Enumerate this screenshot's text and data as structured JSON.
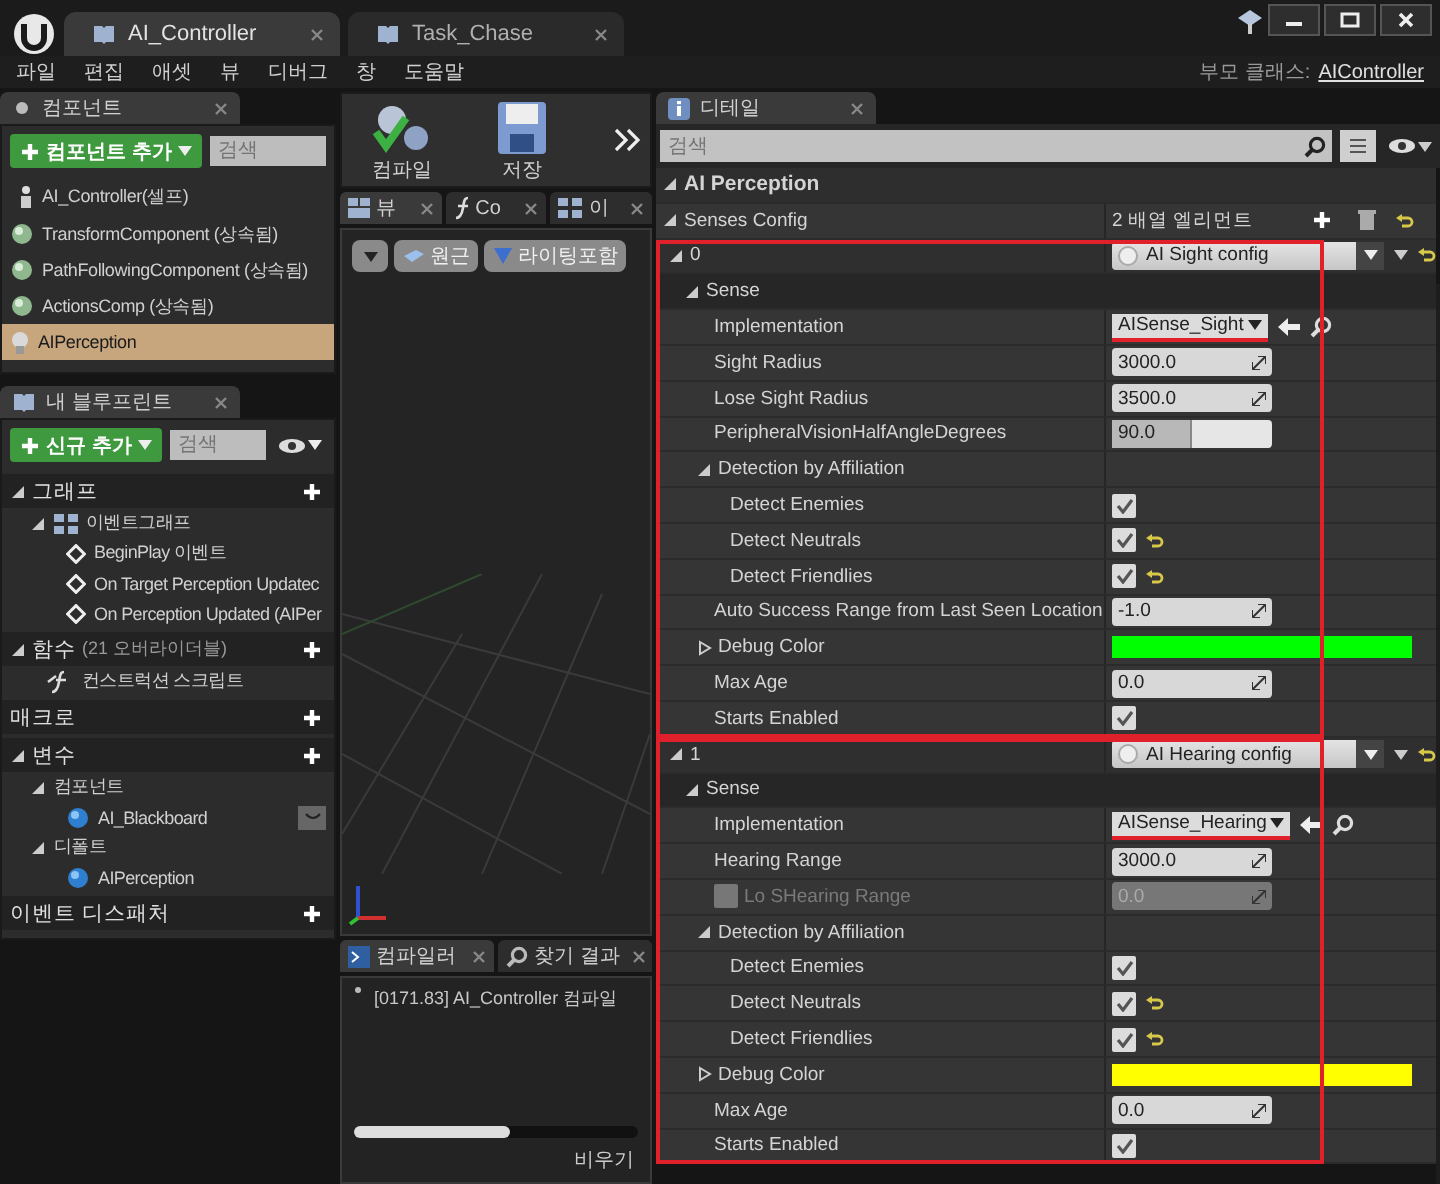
{
  "title_bar": {
    "tabs": [
      {
        "label": "AI_Controller",
        "selected": true
      },
      {
        "label": "Task_Chase",
        "selected": false
      }
    ]
  },
  "menu": {
    "items": [
      "파일",
      "편집",
      "애셋",
      "뷰",
      "디버그",
      "창",
      "도움말"
    ],
    "parent_label": "부모 클래스:",
    "parent_value": "AIController"
  },
  "components": {
    "tab": "컴포넌트",
    "add_button": "컴포넌트 추가",
    "search_placeholder": "검색",
    "items": [
      {
        "label": "AI_Controller(셀프)",
        "kind": "self",
        "selected": false
      },
      {
        "label": "TransformComponent (상속됨)",
        "kind": "component",
        "selected": false
      },
      {
        "label": "PathFollowingComponent (상속됨)",
        "kind": "component",
        "selected": false
      },
      {
        "label": "ActionsComp (상속됨)",
        "kind": "component",
        "selected": false
      },
      {
        "label": "AIPerception",
        "kind": "perception",
        "selected": true
      }
    ]
  },
  "my_blueprint": {
    "tab": "내 블루프린트",
    "add_button": "신규 추가",
    "search_placeholder": "검색",
    "sections": [
      {
        "label": "그래프",
        "expanded": true,
        "addable": true,
        "children": [
          {
            "label": "이벤트그래프",
            "kind": "graph",
            "expanded": true,
            "children": [
              {
                "label": "BeginPlay 이벤트",
                "kind": "event"
              },
              {
                "label": "On Target Perception Updatec",
                "kind": "event"
              },
              {
                "label": "On Perception Updated (AIPer",
                "kind": "event"
              }
            ]
          }
        ]
      },
      {
        "label": "함수",
        "note": "(21 오버라이더블)",
        "expanded": true,
        "addable": true,
        "children": [
          {
            "label": "컨스트럭션 스크립트",
            "kind": "function"
          }
        ]
      },
      {
        "label": "매크로",
        "addable": true
      },
      {
        "label": "변수",
        "expanded": true,
        "addable": true,
        "children": [
          {
            "label": "컴포넌트",
            "kind": "category",
            "expanded": true,
            "children": [
              {
                "label": "AI_Blackboard",
                "kind": "variable",
                "toggle": true
              }
            ]
          },
          {
            "label": "디폴트",
            "kind": "category",
            "expanded": true,
            "children": [
              {
                "label": "AIPerception",
                "kind": "variable"
              }
            ]
          }
        ]
      },
      {
        "label": "이벤트 디스패처",
        "addable": true
      }
    ]
  },
  "toolbar": {
    "buttons": [
      {
        "label": "컴파일",
        "kind": "compile"
      },
      {
        "label": "저장",
        "kind": "save"
      }
    ]
  },
  "graph_tabs": [
    {
      "label": "뷰",
      "kind": "viewport",
      "selected": true
    },
    {
      "label": "Co",
      "kind": "function",
      "selected": false
    },
    {
      "label": "이",
      "kind": "graph",
      "selected": false
    }
  ],
  "viewport": {
    "buttons": [
      {
        "label": "원근",
        "kind": "perspective"
      },
      {
        "label": "라이팅포함",
        "kind": "lit"
      }
    ]
  },
  "compiler": {
    "tabs": [
      {
        "label": "컴파일러",
        "kind": "compiler",
        "selected": true
      },
      {
        "label": "찾기 결과",
        "kind": "find",
        "selected": false
      }
    ],
    "log": [
      "[0171.83] AI_Controller 컴파일"
    ],
    "clear_button": "비우기"
  },
  "details": {
    "tab": "디테일",
    "search_placeholder": "검색",
    "category": {
      "label": "AI Perception",
      "expanded": true
    },
    "senses_config": {
      "label": "Senses Config",
      "expanded": true,
      "count": "2 배열 엘리먼트"
    },
    "elements": [
      {
        "index": "0",
        "expanded": true,
        "config": "AI Sight config",
        "highlighted": true,
        "group": {
          "label": "Sense",
          "expanded": true,
          "rows": [
            {
              "kind": "class",
              "label": "Implementation",
              "value": "AISense_Sight",
              "underlined": true
            },
            {
              "kind": "number",
              "label": "Sight Radius",
              "value": "3000.0"
            },
            {
              "kind": "number",
              "label": "Lose Sight Radius",
              "value": "3500.0"
            },
            {
              "kind": "slider",
              "label": "PeripheralVisionHalfAngleDegrees",
              "value": "90.0",
              "level": 0.5
            },
            {
              "kind": "group",
              "label": "Detection by Affiliation",
              "expanded": true,
              "children": [
                {
                  "kind": "check",
                  "label": "Detect Enemies",
                  "checked": true,
                  "reset": false
                },
                {
                  "kind": "check",
                  "label": "Detect Neutrals",
                  "checked": true,
                  "reset": true
                },
                {
                  "kind": "check",
                  "label": "Detect Friendlies",
                  "checked": true,
                  "reset": true
                }
              ]
            },
            {
              "kind": "number",
              "label": "Auto Success Range from Last Seen Location",
              "value": "-1.0"
            },
            {
              "kind": "color",
              "label": "Debug Color",
              "expanded": false,
              "color": "#00ff00"
            },
            {
              "kind": "number",
              "label": "Max Age",
              "value": "0.0"
            },
            {
              "kind": "check",
              "label": "Starts Enabled",
              "checked": true,
              "reset": false
            }
          ]
        }
      },
      {
        "index": "1",
        "expanded": true,
        "config": "AI Hearing config",
        "highlighted": true,
        "group": {
          "label": "Sense",
          "expanded": true,
          "rows": [
            {
              "kind": "class",
              "label": "Implementation",
              "value": "AISense_Hearing",
              "underlined": true
            },
            {
              "kind": "number",
              "label": "Hearing Range",
              "value": "3000.0"
            },
            {
              "kind": "number",
              "label": "Lo SHearing Range",
              "value": "0.0",
              "disabled": true,
              "edit_checked": false
            },
            {
              "kind": "group",
              "label": "Detection by Affiliation",
              "expanded": true,
              "children": [
                {
                  "kind": "check",
                  "label": "Detect Enemies",
                  "checked": true,
                  "reset": false
                },
                {
                  "kind": "check",
                  "label": "Detect Neutrals",
                  "checked": true,
                  "reset": true
                },
                {
                  "kind": "check",
                  "label": "Detect Friendlies",
                  "checked": true,
                  "reset": true
                }
              ]
            },
            {
              "kind": "color",
              "label": "Debug Color",
              "expanded": false,
              "color": "#ffff00"
            },
            {
              "kind": "number",
              "label": "Max Age",
              "value": "0.0"
            },
            {
              "kind": "check",
              "label": "Starts Enabled",
              "checked": true,
              "reset": false
            }
          ]
        }
      }
    ]
  }
}
